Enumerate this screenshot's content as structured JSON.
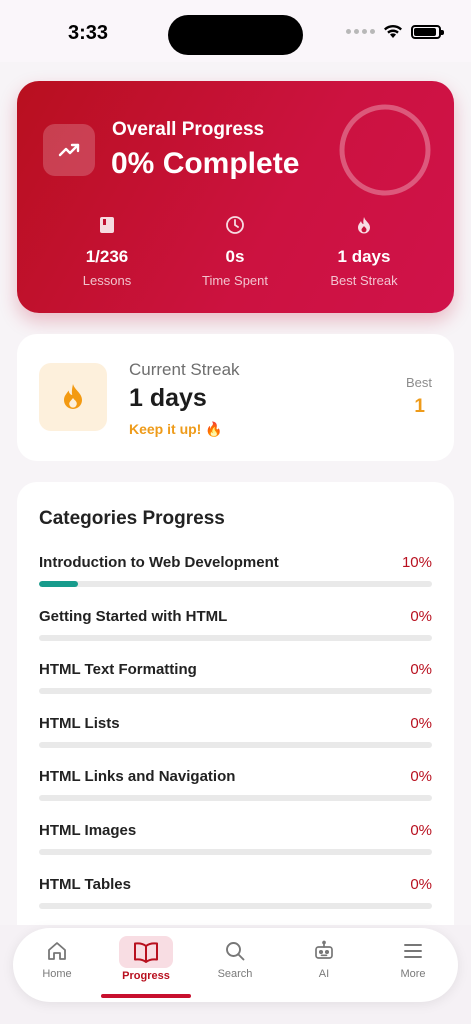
{
  "status_bar": {
    "time": "3:33"
  },
  "overall": {
    "title": "Overall Progress",
    "percent_text": "0% Complete",
    "progress_fraction": 0.0,
    "stats": [
      {
        "icon": "book-icon",
        "value": "1/236",
        "label": "Lessons"
      },
      {
        "icon": "clock-icon",
        "value": "0s",
        "label": "Time Spent"
      },
      {
        "icon": "flame-icon",
        "value": "1 days",
        "label": "Best Streak"
      }
    ]
  },
  "streak": {
    "label": "Current Streak",
    "value": "1 days",
    "message": "Keep it up! 🔥",
    "best_label": "Best",
    "best_value": "1"
  },
  "categories": {
    "title": "Categories Progress",
    "items": [
      {
        "name": "Introduction to Web Development",
        "percent": "10%",
        "fraction": 0.1
      },
      {
        "name": "Getting Started with HTML",
        "percent": "0%",
        "fraction": 0
      },
      {
        "name": "HTML Text Formatting",
        "percent": "0%",
        "fraction": 0
      },
      {
        "name": "HTML Lists",
        "percent": "0%",
        "fraction": 0
      },
      {
        "name": "HTML Links and Navigation",
        "percent": "0%",
        "fraction": 0
      },
      {
        "name": "HTML Images",
        "percent": "0%",
        "fraction": 0
      },
      {
        "name": "HTML Tables",
        "percent": "0%",
        "fraction": 0
      }
    ]
  },
  "nav": {
    "items": [
      {
        "label": "Home",
        "icon": "home-icon"
      },
      {
        "label": "Progress",
        "icon": "open-book-icon",
        "active": true
      },
      {
        "label": "Search",
        "icon": "search-icon"
      },
      {
        "label": "AI",
        "icon": "robot-icon"
      },
      {
        "label": "More",
        "icon": "menu-icon"
      }
    ]
  },
  "colors": {
    "primary": "#c8102e",
    "accent_orange": "#ee9b1a",
    "progress_teal": "#179b8c"
  }
}
